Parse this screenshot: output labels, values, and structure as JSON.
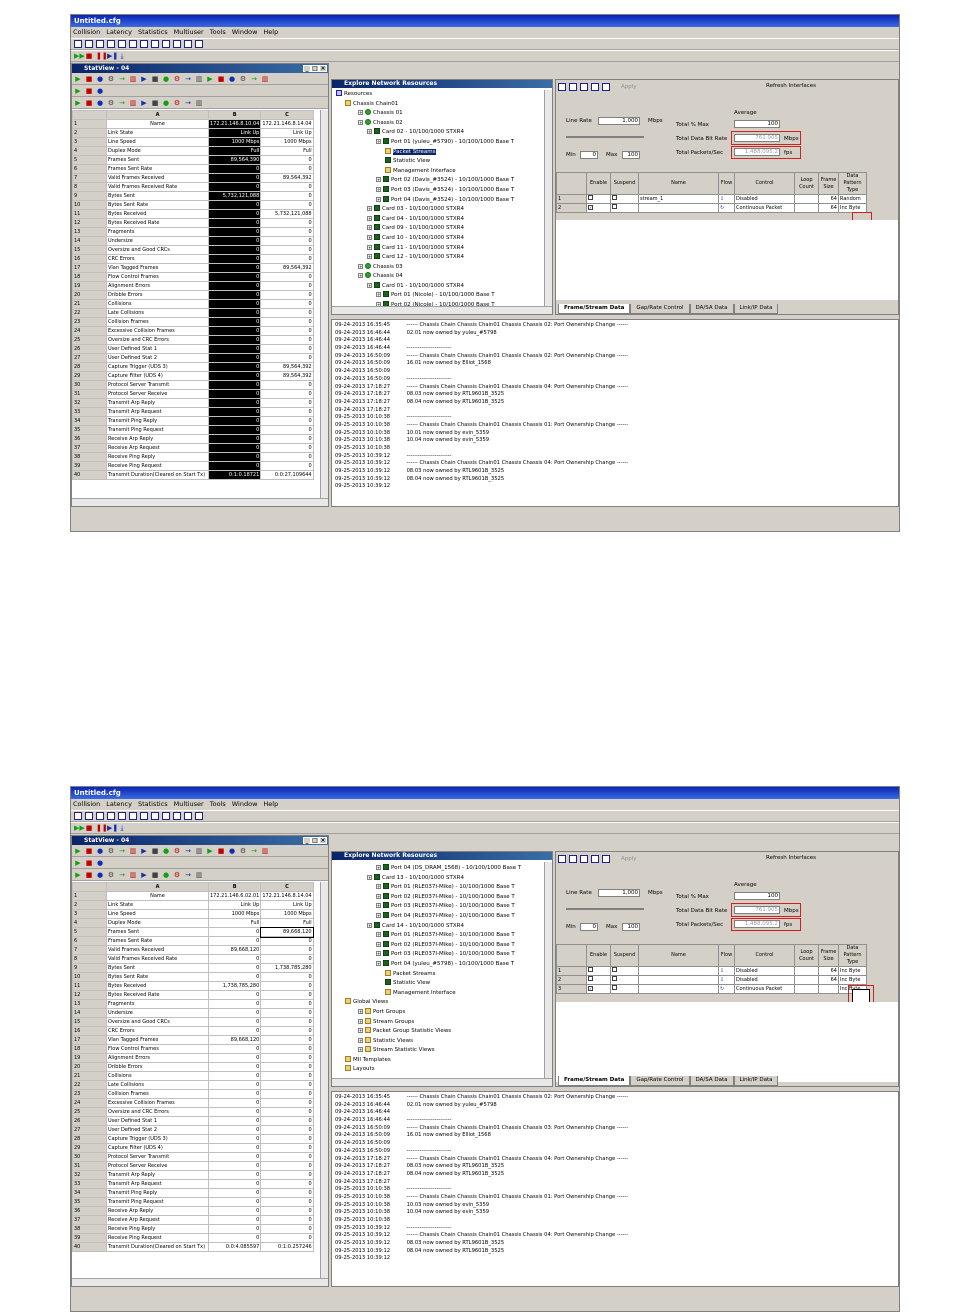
{
  "window": {
    "title": "Untitled.cfg",
    "menus": [
      "Collision",
      "Latency",
      "Statistics",
      "Multiuser",
      "Tools",
      "Window",
      "Help"
    ]
  },
  "panels": {
    "stat_title": "StatView - 04",
    "explore_title": "Explore Network Resources",
    "apply": "Apply",
    "refresh": "Refresh Interfaces"
  },
  "stats": {
    "columns": [
      "A",
      "B",
      "C"
    ],
    "names": [
      "Name",
      "Link State",
      "Line Speed",
      "Duplex Mode",
      "Frames Sent",
      "Frames Sent Rate",
      "Valid Frames Received",
      "Valid Frames Received Rate",
      "Bytes Sent",
      "Bytes Sent Rate",
      "Bytes Received",
      "Bytes Received Rate",
      "Fragments",
      "Undersize",
      "Oversize and Good CRCs",
      "CRC Errors",
      "Vlan Tagged Frames",
      "Flow Control Frames",
      "Alignment Errors",
      "Dribble Errors",
      "Collisions",
      "Late Collisions",
      "Collision Frames",
      "Excessive Collision Frames",
      "Oversize and CRC Errors",
      "User Defined Stat 1",
      "User Defined Stat 2",
      "Capture Trigger (UDS 3)",
      "Capture Filter (UDS 4)",
      "Protocol Server Transmit",
      "Protocol Server Receive",
      "Transmit Arp Reply",
      "Transmit Arp Request",
      "Transmit Ping Reply",
      "Transmit Ping Request",
      "Receive Arp Reply",
      "Receive Arp Request",
      "Receive Ping Reply",
      "Receive Ping Request",
      "Transmit Duration(Cleared on Start Tx)"
    ],
    "a": {
      "b": [
        "172.21.146.8.10.04",
        "Link Up",
        "1000 Mbps",
        "Full",
        "89,564,390",
        "0",
        "0",
        "0",
        "5,732,121,088",
        "0",
        "0",
        "0",
        "0",
        "0",
        "0",
        "0",
        "0",
        "0",
        "0",
        "0",
        "0",
        "0",
        "0",
        "0",
        "0",
        "0",
        "0",
        "0",
        "0",
        "0",
        "0",
        "0",
        "0",
        "0",
        "0",
        "0",
        "0",
        "0",
        "0",
        "0:1:0.18721"
      ],
      "c": [
        "172.21.146.8.14.04",
        "Link Up",
        "1000 Mbps",
        "Full",
        "0",
        "0",
        "89,564,392",
        "0",
        "0",
        "0",
        "5,732,121,088",
        "0",
        "0",
        "0",
        "0",
        "0",
        "89,564,392",
        "0",
        "0",
        "0",
        "0",
        "0",
        "0",
        "0",
        "0",
        "0",
        "0",
        "89,564,392",
        "89,564,392",
        "0",
        "0",
        "0",
        "0",
        "0",
        "0",
        "0",
        "0",
        "0",
        "0",
        "0:0:27.109644"
      ]
    },
    "b": {
      "b": [
        "172.21.146.6.02.01",
        "Link Up",
        "1000 Mbps",
        "Full",
        "0",
        "0",
        "89,668,120",
        "0",
        "0",
        "0",
        "1,738,785,280",
        "0",
        "0",
        "0",
        "0",
        "0",
        "89,668,120",
        "0",
        "0",
        "0",
        "0",
        "0",
        "0",
        "0",
        "0",
        "0",
        "0",
        "0",
        "0",
        "0",
        "0",
        "0",
        "0",
        "0",
        "0",
        "0",
        "0",
        "0",
        "0",
        "0:0:4.085597"
      ],
      "c": [
        "172.21.146.8.14.04",
        "Link Up",
        "1000 Mbps",
        "Full",
        "89,668,120",
        "0",
        "0",
        "0",
        "1,738,785,280",
        "0",
        "0",
        "0",
        "0",
        "0",
        "0",
        "0",
        "0",
        "0",
        "0",
        "0",
        "0",
        "0",
        "0",
        "0",
        "0",
        "0",
        "0",
        "0",
        "0",
        "0",
        "0",
        "0",
        "0",
        "0",
        "0",
        "0",
        "0",
        "0",
        "0",
        "0:1:0.257246"
      ]
    }
  },
  "treeA": [
    {
      "t": "Resources",
      "i": "m",
      "l": 0
    },
    {
      "t": "Chassis Chain01",
      "i": "f",
      "l": 1
    },
    {
      "t": "Chassis 01",
      "i": "c",
      "l": 2
    },
    {
      "t": "Chassis 02",
      "i": "c",
      "l": 2
    },
    {
      "t": "Card 02 - 10/100/1000 STXR4",
      "i": "p",
      "l": 3
    },
    {
      "t": "Port 01 (yuleu_#5790) - 10/100/1000 Base T",
      "i": "p",
      "l": 4
    },
    {
      "t": "Packet Streams",
      "i": "f",
      "l": 5,
      "sel": true
    },
    {
      "t": "Statistic View",
      "i": "p",
      "l": 5
    },
    {
      "t": "Management Interface",
      "i": "f",
      "l": 5
    },
    {
      "t": "Port 02 (Davis_#3524) - 10/100/1000 Base T",
      "i": "p",
      "l": 4
    },
    {
      "t": "Port 03 (Davis_#3524) - 10/100/1000 Base T",
      "i": "p",
      "l": 4
    },
    {
      "t": "Port 04 (Davis_#3524) - 10/100/1000 Base T",
      "i": "p",
      "l": 4
    },
    {
      "t": "Card 03 - 10/100/1000 STXR4",
      "i": "p",
      "l": 3
    },
    {
      "t": "Card 04 - 10/100/1000 STXR4",
      "i": "p",
      "l": 3
    },
    {
      "t": "Card 09 - 10/100/1000 STXR4",
      "i": "p",
      "l": 3
    },
    {
      "t": "Card 10 - 10/100/1000 STXR4",
      "i": "p",
      "l": 3
    },
    {
      "t": "Card 11 - 10/100/1000 STXR4",
      "i": "p",
      "l": 3
    },
    {
      "t": "Card 12 - 10/100/1000 STXR4",
      "i": "p",
      "l": 3
    },
    {
      "t": "Chassis 03",
      "i": "c",
      "l": 2
    },
    {
      "t": "Chassis 04",
      "i": "c",
      "l": 2
    },
    {
      "t": "Card 01 - 10/100/1000 STXR4",
      "i": "p",
      "l": 3
    },
    {
      "t": "Port 01 (Nicole) - 10/100/1000 Base T",
      "i": "p",
      "l": 4
    },
    {
      "t": "Port 02 (Nicole) - 10/100/1000 Base T",
      "i": "p",
      "l": 4
    }
  ],
  "treeB": [
    {
      "t": "Port 04 (DS_DRAM_1568) - 10/100/1000 Base T",
      "i": "p",
      "l": 4
    },
    {
      "t": "Card 13 - 10/100/1000 STXR4",
      "i": "p",
      "l": 3
    },
    {
      "t": "Port 01 (RLE037I-Mike) - 10/100/1000 Base T",
      "i": "p",
      "l": 4
    },
    {
      "t": "Port 02 (RLE037I-Mike) - 10/100/1000 Base T",
      "i": "p",
      "l": 4
    },
    {
      "t": "Port 03 (RLE037I-Mike) - 10/100/1000 Base T",
      "i": "p",
      "l": 4
    },
    {
      "t": "Port 04 (RLE037I-Mike) - 10/100/1000 Base T",
      "i": "p",
      "l": 4
    },
    {
      "t": "Card 14 - 10/100/1000 STXR4",
      "i": "p",
      "l": 3
    },
    {
      "t": "Port 01 (RLE037I-Mike) - 10/100/1000 Base T",
      "i": "p",
      "l": 4
    },
    {
      "t": "Port 02 (RLE037I-Mike) - 10/100/1000 Base T",
      "i": "p",
      "l": 4
    },
    {
      "t": "Port 03 (RLE037I-Mike) - 10/100/1000 Base T",
      "i": "p",
      "l": 4
    },
    {
      "t": "Port 04 (yuleu_#5798) - 10/100/1000 Base T",
      "i": "p",
      "l": 4
    },
    {
      "t": "Packet Streams",
      "i": "f",
      "l": 5
    },
    {
      "t": "Statistic View",
      "i": "p",
      "l": 5
    },
    {
      "t": "Management Interface",
      "i": "f",
      "l": 5
    },
    {
      "t": "Global Views",
      "i": "f",
      "l": 1
    },
    {
      "t": "Port Groups",
      "i": "f",
      "l": 2
    },
    {
      "t": "Stream Groups",
      "i": "f",
      "l": 2
    },
    {
      "t": "Packet Group Statistic Views",
      "i": "f",
      "l": 2
    },
    {
      "t": "Statistic Views",
      "i": "f",
      "l": 2
    },
    {
      "t": "Stream Statistic Views",
      "i": "f",
      "l": 2
    },
    {
      "t": "MII Templates",
      "i": "f",
      "l": 1
    },
    {
      "t": "Layouts",
      "i": "f",
      "l": 1
    }
  ],
  "logA": [
    "09-24-2013 16:35:45|------ Chassis Chain Chassis Chain01 Chassis Chassis 02: Port Ownership Change ------",
    "09-24-2013 16:46:44|02.01 now owned by yuleu_#5798",
    "09-24-2013 16:46:44|",
    "09-24-2013 16:46:44|------------------------",
    "09-24-2013 16:50:09|------ Chassis Chain Chassis Chain01 Chassis Chassis 02: Port Ownership Change ------",
    "09-24-2013 16:50:09|16.01 now owned by Elliot_1568",
    "09-24-2013 16:50:09|",
    "09-24-2013 16:50:09|------------------------",
    "09-24-2013 17:18:27|------ Chassis Chain Chassis Chain01 Chassis Chassis 04: Port Ownership Change ------",
    "09-24-2013 17:18:27|08.03 now owned by RTL9601B_3525",
    "09-24-2013 17:18:27|08.04 now owned by RTL9601B_3525",
    "09-24-2013 17:18:27|",
    "09-25-2013 10:10:38|------------------------",
    "09-25-2013 10:10:38|------ Chassis Chain Chassis Chain01 Chassis Chassis 01: Port Ownership Change ------",
    "09-25-2013 10:10:38|10.01 now owned by evin_5359",
    "09-25-2013 10:10:38|10.04 now owned by evin_5359",
    "09-25-2013 10:10:38|",
    "09-25-2013 10:39:12|------------------------",
    "09-25-2013 10:39:12|------ Chassis Chain Chassis Chain01 Chassis Chassis 04: Port Ownership Change ------",
    "09-25-2013 10:39:12|08.03 now owned by RTL9601B_3525",
    "09-25-2013 10:39:12|08.04 now owned by RTL9601B_3525",
    "09-25-2013 10:39:12|"
  ],
  "logB": [
    "09-24-2013 16:35:45|------ Chassis Chain Chassis Chain01 Chassis Chassis 02: Port Ownership Change ------",
    "09-24-2013 16:46:44|02.01 now owned by yuleu_#5798",
    "09-24-2013 16:46:44|",
    "09-24-2013 16:46:44|------------------------",
    "09-24-2013 16:50:09|------ Chassis Chain Chassis Chain01 Chassis Chassis 03: Port Ownership Change ------",
    "09-24-2013 16:50:09|16.01 now owned by Elliot_1568",
    "09-24-2013 16:50:09|",
    "09-24-2013 16:50:09|------------------------",
    "09-24-2013 17:18:27|------ Chassis Chain Chassis Chain01 Chassis Chassis 04: Port Ownership Change ------",
    "09-24-2013 17:18:27|08.03 now owned by RTL9601B_3525",
    "09-24-2013 17:18:27|08.04 now owned by RTL9601B_3525",
    "09-24-2013 17:18:27|",
    "09-25-2013 10:10:38|------------------------",
    "09-25-2013 10:10:38|------ Chassis Chain Chassis Chain01 Chassis Chassis 01: Port Ownership Change ------",
    "09-25-2013 10:10:38|10.03 now owned by evin_5359",
    "09-25-2013 10:10:38|10.04 now owned by evin_5359",
    "09-25-2013 10:10:38|",
    "09-25-2013 10:39:12|------------------------",
    "09-25-2013 10:39:12|------ Chassis Chain Chassis Chain01 Chassis Chassis 04: Port Ownership Change ------",
    "09-25-2013 10:39:12|08.03 now owned by RTL9601B_3525",
    "09-25-2013 10:39:12|08.04 now owned by RTL9601B_3525",
    "09-25-2013 10:39:12|"
  ],
  "rate": {
    "line_rate": "Line Rate",
    "line_value": "1,000",
    "mbps": "Mbps",
    "min": "Min",
    "min_val": "0",
    "max": "Max",
    "max_val": "100",
    "average": "Average",
    "total_max": "Total % Max",
    "total_max_val": "100",
    "total_bit": "Total Data Bit Rate",
    "bit_val": "761.905",
    "bit_unit": "Mbps",
    "total_pkt": "Total Packets/Sec",
    "pkt_val": "1,488,095.2",
    "pkt_unit": "fps"
  },
  "stream_headers": [
    "",
    "Enable",
    "Suspend",
    "Name",
    "Flow",
    "Control",
    "Loop Count",
    "Frame Size",
    "Data Pattern Type"
  ],
  "streamsA": [
    [
      "1",
      "",
      "",
      "stream_1",
      "",
      "Disabled",
      "",
      "64",
      "Random"
    ],
    [
      "2",
      "",
      "",
      "",
      "",
      "Continuous Packet",
      "",
      "64",
      "Inc Byte"
    ]
  ],
  "streamsB": [
    [
      "1",
      "",
      "",
      "",
      "",
      "Disabled",
      "",
      "64",
      "Inc Byte"
    ],
    [
      "2",
      "",
      "",
      "",
      "",
      "Disabled",
      "",
      "64",
      "Inc Byte"
    ],
    [
      "3",
      "",
      "",
      "",
      "",
      "Continuous Packet",
      "",
      "",
      "Inc Byte"
    ]
  ],
  "tabs": [
    "Frame/Stream Data",
    "Gap/Rate Control",
    "DA/SA Data",
    "Link/IP Data"
  ]
}
